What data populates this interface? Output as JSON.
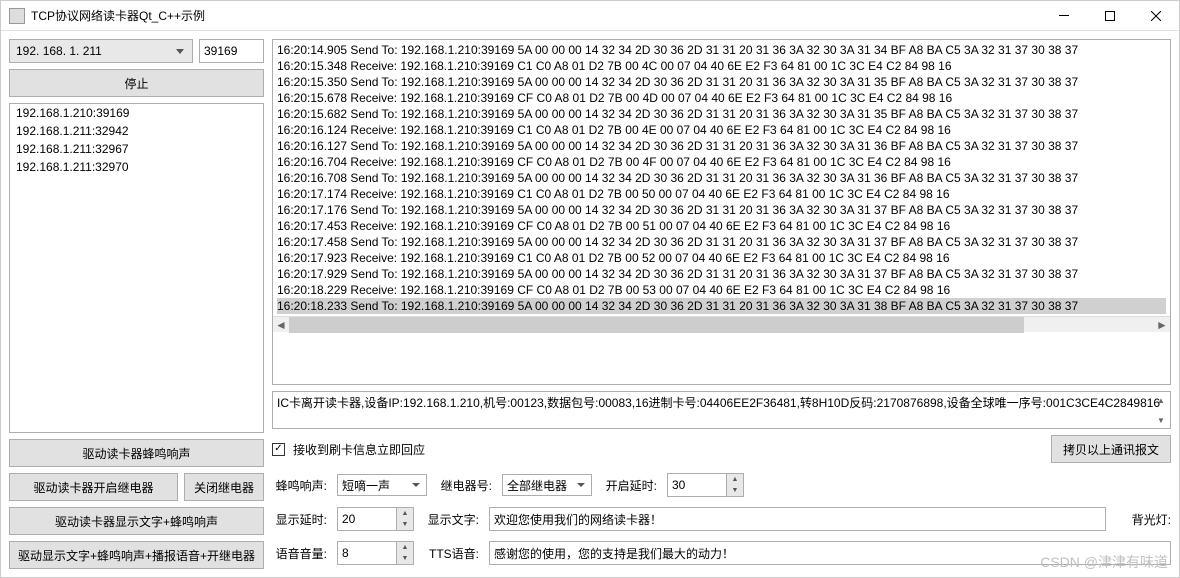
{
  "window": {
    "title": "TCP协议网络读卡器Qt_C++示例"
  },
  "left": {
    "ip_combo": "192. 168. 1. 211",
    "port": "39169",
    "stop_btn": "停止",
    "clients": [
      "192.168.1.210:39169",
      "192.168.1.211:32942",
      "192.168.1.211:32967",
      "192.168.1.211:32970"
    ],
    "btns": {
      "buzz": "驱动读卡器蜂鸣响声",
      "relay_on": "驱动读卡器开启继电器",
      "relay_off": "关闭继电器",
      "text_buzz": "驱动读卡器显示文字+蜂鸣响声",
      "all": "驱动显示文字+蜂鸣响声+播报语音+开继电器"
    }
  },
  "log": {
    "lines": [
      "16:20:14.905 Send To: 192.168.1.210:39169    5A 00 00 00 14 32 34 2D 30 36 2D 31 31 20 31 36 3A 32 30 3A 31 34 BF A8 BA C5 3A 32 31 37 30 38 37",
      "16:20:15.348 Receive: 192.168.1.210:39169    C1 C0 A8 01 D2 7B 00 4C 00 07 04 40 6E E2 F3 64 81 00 1C 3C E4 C2 84 98 16",
      "16:20:15.350 Send To: 192.168.1.210:39169    5A 00 00 00 14 32 34 2D 30 36 2D 31 31 20 31 36 3A 32 30 3A 31 35 BF A8 BA C5 3A 32 31 37 30 38 37",
      "16:20:15.678 Receive: 192.168.1.210:39169    CF C0 A8 01 D2 7B 00 4D 00 07 04 40 6E E2 F3 64 81 00 1C 3C E4 C2 84 98 16",
      "16:20:15.682 Send To: 192.168.1.210:39169    5A 00 00 00 14 32 34 2D 30 36 2D 31 31 20 31 36 3A 32 30 3A 31 35 BF A8 BA C5 3A 32 31 37 30 38 37",
      "16:20:16.124 Receive: 192.168.1.210:39169    C1 C0 A8 01 D2 7B 00 4E 00 07 04 40 6E E2 F3 64 81 00 1C 3C E4 C2 84 98 16",
      "16:20:16.127 Send To: 192.168.1.210:39169    5A 00 00 00 14 32 34 2D 30 36 2D 31 31 20 31 36 3A 32 30 3A 31 36 BF A8 BA C5 3A 32 31 37 30 38 37",
      "16:20:16.704 Receive: 192.168.1.210:39169    CF C0 A8 01 D2 7B 00 4F 00 07 04 40 6E E2 F3 64 81 00 1C 3C E4 C2 84 98 16",
      "16:20:16.708 Send To: 192.168.1.210:39169    5A 00 00 00 14 32 34 2D 30 36 2D 31 31 20 31 36 3A 32 30 3A 31 36 BF A8 BA C5 3A 32 31 37 30 38 37",
      "16:20:17.174 Receive: 192.168.1.210:39169    C1 C0 A8 01 D2 7B 00 50 00 07 04 40 6E E2 F3 64 81 00 1C 3C E4 C2 84 98 16",
      "16:20:17.176 Send To: 192.168.1.210:39169    5A 00 00 00 14 32 34 2D 30 36 2D 31 31 20 31 36 3A 32 30 3A 31 37 BF A8 BA C5 3A 32 31 37 30 38 37",
      "16:20:17.453 Receive: 192.168.1.210:39169    CF C0 A8 01 D2 7B 00 51 00 07 04 40 6E E2 F3 64 81 00 1C 3C E4 C2 84 98 16",
      "16:20:17.458 Send To: 192.168.1.210:39169    5A 00 00 00 14 32 34 2D 30 36 2D 31 31 20 31 36 3A 32 30 3A 31 37 BF A8 BA C5 3A 32 31 37 30 38 37",
      "16:20:17.923 Receive: 192.168.1.210:39169    C1 C0 A8 01 D2 7B 00 52 00 07 04 40 6E E2 F3 64 81 00 1C 3C E4 C2 84 98 16",
      "16:20:17.929 Send To: 192.168.1.210:39169    5A 00 00 00 14 32 34 2D 30 36 2D 31 31 20 31 36 3A 32 30 3A 31 37 BF A8 BA C5 3A 32 31 37 30 38 37",
      "16:20:18.229 Receive: 192.168.1.210:39169    CF C0 A8 01 D2 7B 00 53 00 07 04 40 6E E2 F3 64 81 00 1C 3C E4 C2 84 98 16",
      "16:20:18.233 Send To: 192.168.1.210:39169    5A 00 00 00 14 32 34 2D 30 36 2D 31 31 20 31 36 3A 32 30 3A 31 38 BF A8 BA C5 3A 32 31 37 30 38 37"
    ],
    "selected": 16
  },
  "info": "IC卡离开读卡器,设备IP:192.168.1.210,机号:00123,数据包号:00083,16进制卡号:04406EE2F36481,转8H10D反码:2170876898,设备全球唯一序号:001C3CE4C2849816",
  "chk": {
    "label": "接收到刷卡信息立即回应",
    "checked": true
  },
  "copy_btn": "拷贝以上通讯报文",
  "controls": {
    "buzz_label": "蜂鸣响声:",
    "buzz_value": "短嘀一声",
    "relay_label": "继电器号:",
    "relay_value": "全部继电器",
    "delay_on_label": "开启延时:",
    "delay_on_value": "30",
    "disp_delay_label": "显示延时:",
    "disp_delay_value": "20",
    "disp_text_label": "显示文字:",
    "disp_text_value": "欢迎您使用我们的网络读卡器！",
    "backlight_label": "背光灯:",
    "volume_label": "语音音量:",
    "volume_value": "8",
    "tts_label": "TTS语音:",
    "tts_value": "感谢您的使用，您的支持是我们最大的动力！"
  },
  "watermark": "CSDN @津津有味道"
}
